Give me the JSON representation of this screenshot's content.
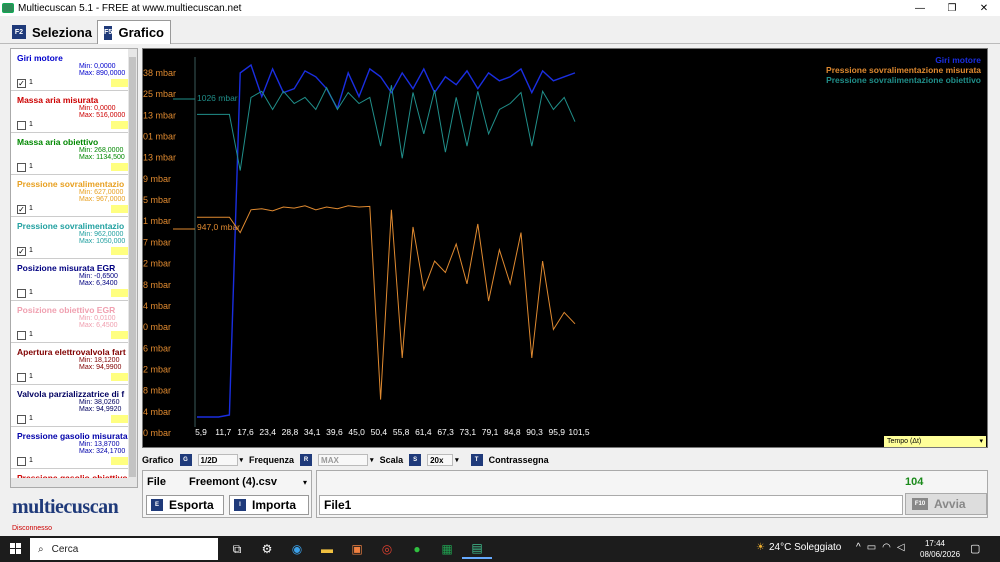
{
  "window": {
    "title": "Multiecuscan 5.1 - FREE at www.multiecuscan.net",
    "minimize": "—",
    "maximize": "❐",
    "close": "✕"
  },
  "tabs": [
    {
      "key": "F2",
      "label": "Seleziona"
    },
    {
      "key": "F5",
      "label": "Grafico"
    }
  ],
  "params": [
    {
      "name": "Giri motore",
      "min": "Min: 0,0000",
      "max": "Max: 890,0000",
      "checked": true,
      "num": "1",
      "color": "#0000cc"
    },
    {
      "name": "Massa aria misurata",
      "min": "Min: 0,0000",
      "max": "Max: 516,0000",
      "checked": false,
      "num": "1",
      "color": "#cc0000"
    },
    {
      "name": "Massa aria obiettivo",
      "min": "Min: 268,0000",
      "max": "Max: 1134,500",
      "checked": false,
      "num": "1",
      "color": "#008800"
    },
    {
      "name": "Pressione sovralimentazio",
      "min": "Min: 627,0000",
      "max": "Max: 967,0000",
      "checked": true,
      "num": "1",
      "color": "#e8a020"
    },
    {
      "name": "Pressione sovralimentazio",
      "min": "Min: 962,0000",
      "max": "Max: 1050,000",
      "checked": true,
      "num": "1",
      "color": "#20a0a0"
    },
    {
      "name": "Posizione misurata EGR",
      "min": "Min: -0,6500",
      "max": "Max: 6,3400",
      "checked": false,
      "num": "1",
      "color": "#000080"
    },
    {
      "name": "Posizione obiettivo EGR",
      "min": "Min: 0,0100",
      "max": "Max: 6,4500",
      "checked": false,
      "num": "1",
      "color": "#f0a0b0"
    },
    {
      "name": "Apertura elettrovalvola fart",
      "min": "Min: 18,1200",
      "max": "Max: 94,9900",
      "checked": false,
      "num": "1",
      "color": "#800000"
    },
    {
      "name": "Valvola parzializzatrice di f",
      "min": "Min: 38,0260",
      "max": "Max: 94,9920",
      "checked": false,
      "num": "1",
      "color": "#000060"
    },
    {
      "name": "Pressione gasolio misurata",
      "min": "Min: 13,8700",
      "max": "Max: 324,1700",
      "checked": false,
      "num": "1",
      "color": "#0000aa"
    },
    {
      "name": "Pressione gasolio obiettivo",
      "min": "",
      "max": "",
      "checked": false,
      "num": "",
      "color": "#cc0000"
    }
  ],
  "logo": "multiecuscan",
  "status": "Disconnesso",
  "chart_data": {
    "type": "line",
    "title": "",
    "xlabel": "Tempo (Δt)",
    "x_ticks": [
      "5,9",
      "11,7",
      "17,6",
      "23,4",
      "28,8",
      "34,1",
      "39,6",
      "45,0",
      "50,4",
      "55,8",
      "61,4",
      "67,3",
      "73,1",
      "79,1",
      "84,8",
      "90,3",
      "95,9",
      "101,5"
    ],
    "y_ticks": [
      "38 mbar",
      "25 mbar",
      "13 mbar",
      "01 mbar",
      "13 mbar",
      "9 mbar",
      "5 mbar",
      "1 mbar",
      "7 mbar",
      "2 mbar",
      "8 mbar",
      "4 mbar",
      "0 mbar",
      "6 mbar",
      "2 mbar",
      "8 mbar",
      "4 mbar",
      "0 mbar"
    ],
    "annotations": [
      "1026 mbar",
      "947,0 mbar"
    ],
    "legend": [
      "Giri motore",
      "Pressione sovralimentazione misurata",
      "Pressione sovralimentazione obiettivo"
    ],
    "series": [
      {
        "name": "Giri motore",
        "color": "#1a2ee0",
        "values": [
          0,
          0,
          0,
          5,
          870,
          890,
          810,
          880,
          820,
          830,
          875,
          860,
          830,
          780,
          870,
          810,
          880,
          860,
          820,
          870,
          830,
          880,
          820,
          860,
          840,
          875,
          830,
          870,
          850,
          860,
          880,
          820,
          875,
          850,
          860,
          870
        ]
      },
      {
        "name": "Pressione sovralimentazione misurata",
        "color": "#e08a30",
        "values": [
          947,
          947,
          947,
          947,
          920,
          960,
          962,
          958,
          965,
          963,
          967,
          960,
          965,
          962,
          967,
          965,
          966,
          627,
          960,
          700,
          930,
          820,
          870,
          850,
          900,
          830,
          935,
          800,
          890,
          830,
          920,
          700,
          870,
          750,
          780,
          760
        ]
      },
      {
        "name": "Pressione sovralimentazione obiettivo",
        "color": "#208f8a",
        "values": [
          1026,
          1026,
          1026,
          1026,
          980,
          1040,
          1045,
          1030,
          1045,
          1035,
          1040,
          1030,
          1048,
          1030,
          1044,
          1035,
          1040,
          1000,
          1050,
          990,
          1044,
          1010,
          1046,
          995,
          1040,
          1000,
          1045,
          1010,
          1030,
          1035,
          1044,
          1000,
          1045,
          1030,
          1040,
          1020
        ]
      }
    ]
  },
  "controls": {
    "grafico_label": "Grafico",
    "grafico_key": "G",
    "grafico_value": "1/2D",
    "freq_label": "Frequenza",
    "freq_key": "R",
    "freq_value": "MAX",
    "scala_label": "Scala",
    "scala_key": "S",
    "scala_value": "20x",
    "mark_key": "T",
    "mark_label": "Contrassegna"
  },
  "file": {
    "label": "File",
    "name": "Freemont (4).csv",
    "export_key": "E",
    "export_label": "Esporta",
    "import_key": "I",
    "import_label": "Importa"
  },
  "run": {
    "count": "104",
    "filename": "File1",
    "avvia_key": "F10",
    "avvia_label": "Avvia"
  },
  "taskbar": {
    "search": "Cerca",
    "weather": "24°C Soleggiato",
    "time": "17:44",
    "date": "08/06/2026"
  }
}
